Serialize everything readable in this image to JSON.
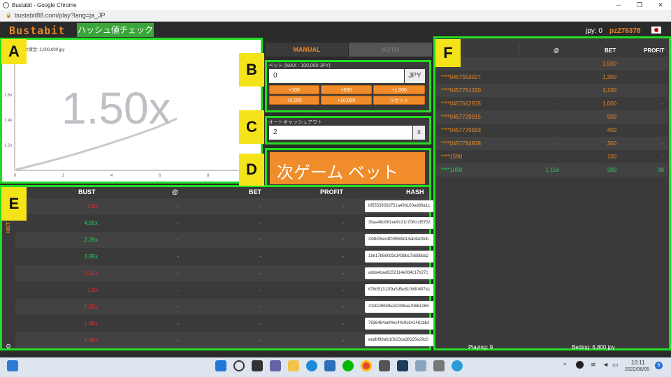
{
  "window": {
    "title": "Bustabit - Google Chrome",
    "min": "─",
    "max": "❐",
    "close": "✕"
  },
  "address": {
    "url": "bustabit88.com/play?lang=ja_JP"
  },
  "header": {
    "logo": "Bustabit",
    "hash_check": "ハッシュ値チェック",
    "balance": "jpy: 0",
    "username": "pz276378"
  },
  "labels": {
    "a": "A",
    "b": "B",
    "c": "C",
    "d": "D",
    "e": "E",
    "f": "F"
  },
  "graph": {
    "max_label": "最大賞金: 2,000,000 jpy",
    "multiplier": "1.50x",
    "y_ticks": [
      "1.6x",
      "1.4x",
      "1.2x"
    ],
    "x_ticks": [
      "0",
      "2",
      "4",
      "6",
      "8"
    ]
  },
  "tabs": {
    "manual": "MANUAL",
    "auto": "AUTO"
  },
  "bet": {
    "label": "ベット (MAX : 100,000 JPY)",
    "value": "0",
    "unit": "JPY",
    "buttons": [
      "+100",
      "+500",
      "+1,000",
      "+5,000",
      "+10,000",
      "リセット"
    ]
  },
  "cashout": {
    "label": "オートキャッシュアウト",
    "value": "2",
    "unit": "x"
  },
  "bet_button": {
    "label": "次ゲーム ベット"
  },
  "history": {
    "side_label": "HIST",
    "headers": [
      "BUST",
      "@",
      "BET",
      "PROFIT",
      "HASH"
    ],
    "rows": [
      {
        "bust": "1.8x",
        "color": "#ee2a2a",
        "at": "-",
        "bet": "-",
        "profit": "-",
        "hash": "bf5553935d751a49b163ed68a1c"
      },
      {
        "bust": "4.55x",
        "color": "#2fcf5f",
        "at": "-",
        "bet": "-",
        "profit": "-",
        "hash": "3baa48d061ee9c21c708ccd5702"
      },
      {
        "bust": "2.26x",
        "color": "#2fcf5f",
        "at": "-",
        "bet": "-",
        "profit": "-",
        "hash": "344b05ec4f03f569d14ab4a09cb"
      },
      {
        "bust": "3.95x",
        "color": "#2fcf5f",
        "at": "-",
        "bet": "-",
        "profit": "-",
        "hash": "18e17b660d3c1438bc7a65bba2"
      },
      {
        "bust": "1.11x",
        "color": "#ee2a2a",
        "at": "-",
        "bet": "-",
        "profit": "-",
        "hash": "adda4caa6232114e084c17b27c"
      },
      {
        "bust": "1.8x",
        "color": "#ee2a2a",
        "at": "-",
        "bet": "-",
        "profit": "-",
        "hash": "678d51312f9a5d5e810690457e1"
      },
      {
        "bust": "1.15x",
        "color": "#ee2a2a",
        "at": "-",
        "bet": "-",
        "profit": "-",
        "hash": "411b2469d5a32396aa7b661368"
      },
      {
        "bust": "1.86x",
        "color": "#ee2a2a",
        "at": "-",
        "bet": "-",
        "profit": "-",
        "hash": "7936484aef4ec44c9c641481bb2"
      },
      {
        "bust": "1.46x",
        "color": "#ee2a2a",
        "at": "-",
        "bet": "-",
        "profit": "-",
        "hash": "eedbf98afc10b23ca38325e29c0"
      }
    ]
  },
  "players": {
    "headers": [
      "@",
      "BET",
      "PROFIT"
    ],
    "rows": [
      {
        "name": "****70",
        "at": "-",
        "bet": "1,500",
        "profit": "-",
        "name_color": "#e78a2a"
      },
      {
        "name": "****0457553027",
        "at": "-",
        "bet": "1,300",
        "profit": "-",
        "name_color": "#e78a2a"
      },
      {
        "name": "****0457761330",
        "at": "-",
        "bet": "1,100",
        "profit": "-",
        "name_color": "#e78a2a"
      },
      {
        "name": "****0457562935",
        "at": "-",
        "bet": "1,000",
        "profit": "-",
        "name_color": "#e78a2a"
      },
      {
        "name": "****0457729915",
        "at": "-",
        "bet": "900",
        "profit": "-",
        "name_color": "#e78a2a"
      },
      {
        "name": "****0457770583",
        "at": "-",
        "bet": "400",
        "profit": "-",
        "name_color": "#e78a2a"
      },
      {
        "name": "****0457784928",
        "at": "-",
        "bet": "300",
        "profit": "-",
        "name_color": "#e78a2a"
      },
      {
        "name": "****1590",
        "at": "-",
        "bet": "100",
        "profit": "-",
        "name_color": "#e78a2a"
      },
      {
        "name": "****1058",
        "at": "1.15x",
        "bet": "200",
        "profit": "30",
        "name_color": "#2fcf5f"
      }
    ],
    "playing": "Playing: 9",
    "betting": "Betting: 6,800 jpy"
  },
  "taskbar": {
    "time": "10:11",
    "date": "2022/08/05",
    "badge": "6"
  }
}
